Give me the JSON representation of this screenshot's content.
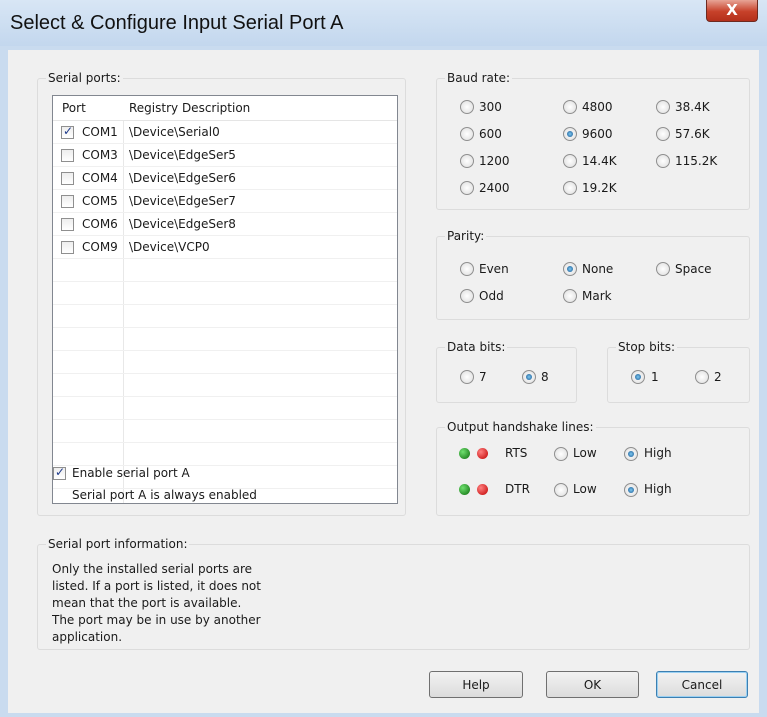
{
  "window": {
    "title": "Select & Configure Input Serial Port A",
    "close_label": "X"
  },
  "serial_ports": {
    "label": "Serial ports:",
    "columns": [
      "Port",
      "Registry Description"
    ],
    "rows": [
      {
        "port": "COM1",
        "desc": "\\Device\\Serial0",
        "checked": true
      },
      {
        "port": "COM3",
        "desc": "\\Device\\EdgeSer5",
        "checked": false
      },
      {
        "port": "COM4",
        "desc": "\\Device\\EdgeSer6",
        "checked": false
      },
      {
        "port": "COM5",
        "desc": "\\Device\\EdgeSer7",
        "checked": false
      },
      {
        "port": "COM6",
        "desc": "\\Device\\EdgeSer8",
        "checked": false
      },
      {
        "port": "COM9",
        "desc": "\\Device\\VCP0",
        "checked": false
      }
    ],
    "enable_label": "Enable serial port A",
    "enable_checked": true,
    "note": "Serial port A is always enabled"
  },
  "baud": {
    "label": "Baud rate:",
    "options": [
      "300",
      "4800",
      "38.4K",
      "600",
      "9600",
      "57.6K",
      "1200",
      "14.4K",
      "115.2K",
      "2400",
      "19.2K"
    ],
    "selected": "9600"
  },
  "parity": {
    "label": "Parity:",
    "options": [
      "Even",
      "None",
      "Space",
      "Odd",
      "Mark"
    ],
    "selected": "None"
  },
  "data_bits": {
    "label": "Data bits:",
    "options": [
      "7",
      "8"
    ],
    "selected": "8"
  },
  "stop_bits": {
    "label": "Stop bits:",
    "options": [
      "1",
      "2"
    ],
    "selected": "1"
  },
  "handshake": {
    "label": "Output handshake lines:",
    "lines": [
      {
        "name": "RTS",
        "low": "Low",
        "high": "High",
        "selected": "High"
      },
      {
        "name": "DTR",
        "low": "Low",
        "high": "High",
        "selected": "High"
      }
    ]
  },
  "info": {
    "label": "Serial port information:",
    "lines": [
      "Only the installed serial ports are",
      "listed.  If a port is listed, it does not",
      "mean that the port is available.",
      "The port may be in use by another",
      "application."
    ]
  },
  "buttons": {
    "help": "Help",
    "ok": "OK",
    "cancel": "Cancel"
  },
  "colors": {
    "accent": "#16548e",
    "led_green": "#0b6b0b",
    "led_red": "#c00000",
    "close": "#c7412a"
  }
}
